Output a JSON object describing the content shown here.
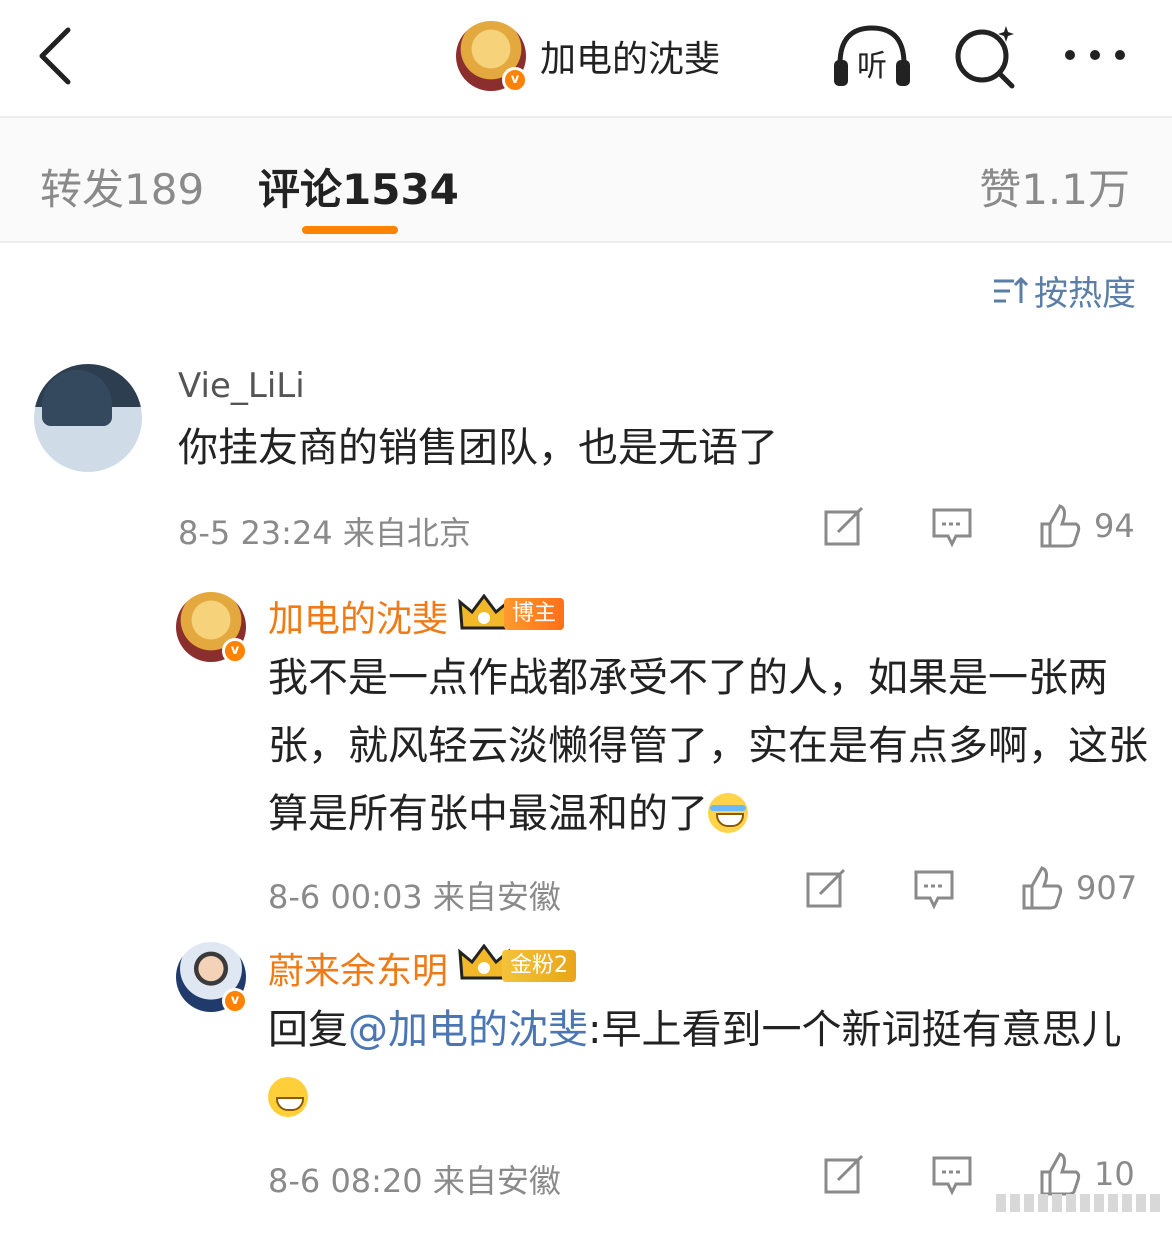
{
  "header": {
    "title": "加电的沈斐",
    "listen_label": "听"
  },
  "tabs": {
    "repost": "转发189",
    "comment": "评论1534",
    "like": "赞1.1万"
  },
  "sort": {
    "label": "按热度"
  },
  "comments": [
    {
      "author": "Vie_LiLi",
      "text": "你挂友商的销售团队，也是无语了",
      "time": "8-5 23:24",
      "location": "来自北京",
      "likes": "94"
    }
  ],
  "replies": [
    {
      "author": "加电的沈斐",
      "badge": "博主",
      "text": "我不是一点作战都承受不了的人，如果是一张两张，就风轻云淡懒得管了，实在是有点多啊，这张算是所有张中最温和的了",
      "time": "8-6 00:03",
      "location": "来自安徽",
      "likes": "907"
    },
    {
      "author": "蔚来余东明",
      "badge": "金粉2",
      "reply_prefix": "回复",
      "mention": "@加电的沈斐",
      "text": ":早上看到一个新词挺有意思儿",
      "time": "8-6 08:20",
      "location": "来自安徽",
      "likes": "10"
    }
  ],
  "colors": {
    "accent": "#ff8200",
    "link": "#4a76b3",
    "name_orange": "#f07a16"
  }
}
